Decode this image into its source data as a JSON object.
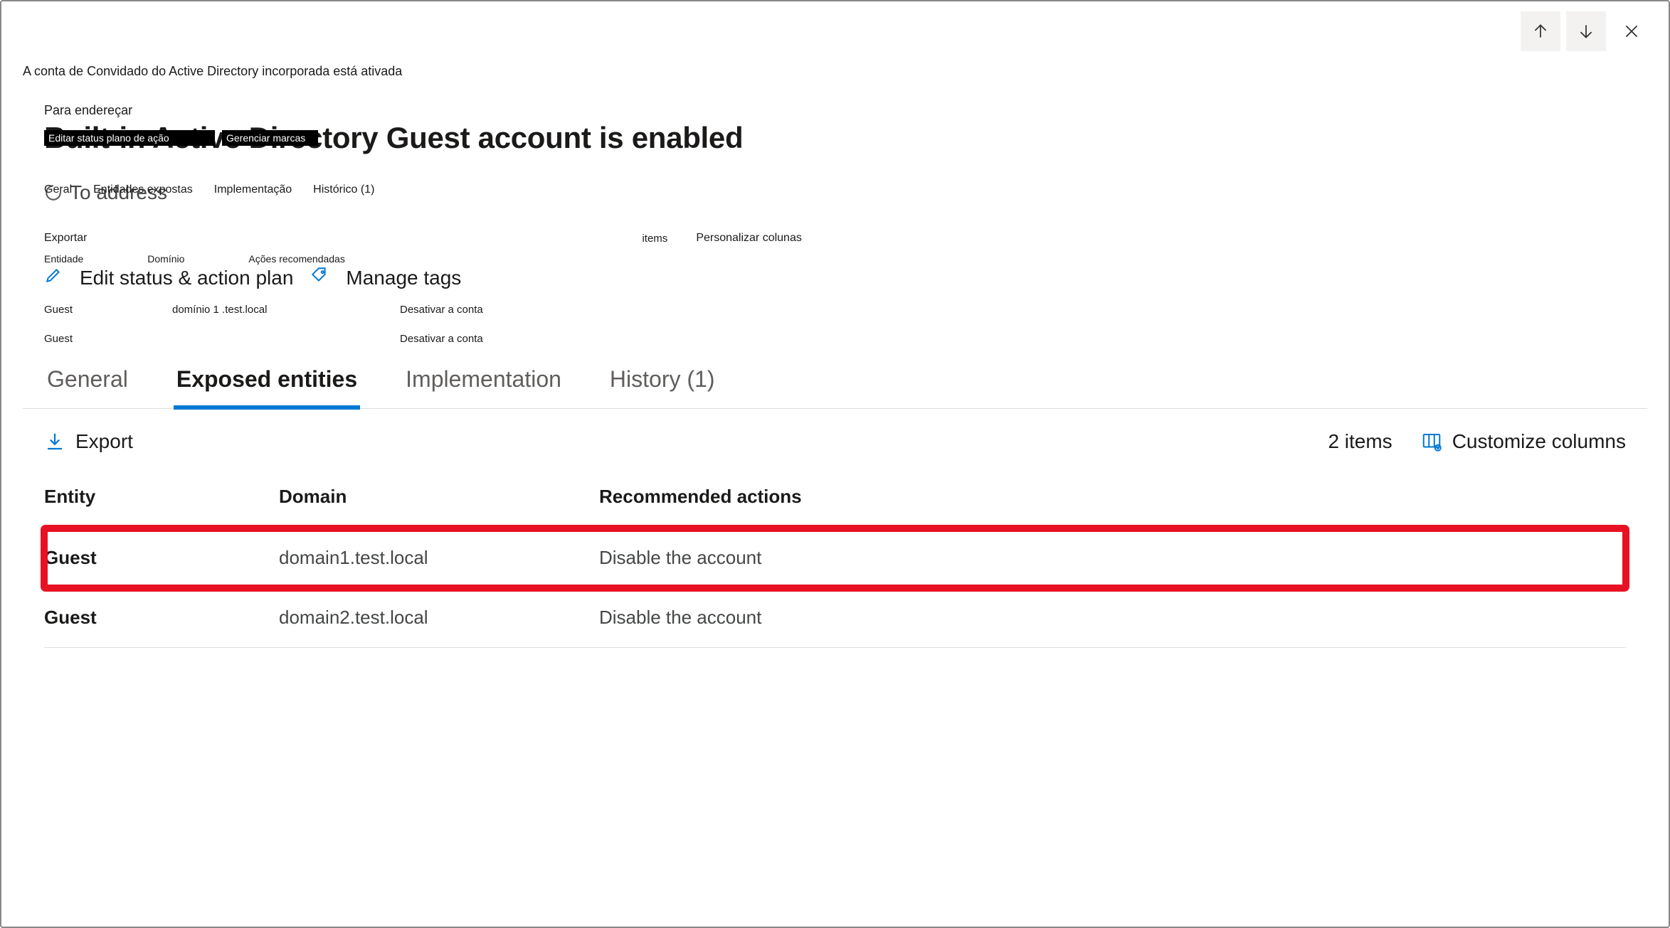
{
  "header_icons": {
    "up": "arrow-up-icon",
    "down": "arrow-down-icon",
    "close": "close-icon"
  },
  "localized_caption": "A conta de Convidado do Active Directory incorporada está ativada",
  "ghost": {
    "subtitle": "Para endereçar",
    "title": "Built-in Active Directory Guest account is enabled",
    "pill_a": "Editar status plano de ação",
    "pill_b": "Gerenciar marcas",
    "to_address": "To address",
    "tabs": [
      "Geral",
      "Entidades expostas",
      "Implementação",
      "Histórico (1)"
    ],
    "export_row": {
      "export": "Exportar",
      "items": "items",
      "customize": "Personalizar colunas"
    },
    "action_row": {
      "mini_labels": [
        "Entidade",
        "Domínio",
        "Ações recomendadas"
      ],
      "edit_label": "Edit status & action plan",
      "manage_label": "Manage tags"
    },
    "table_rows": [
      {
        "entity": "Guest",
        "domain": "domínio 1 .test.local",
        "action": "Desativar a conta"
      },
      {
        "entity": "Guest",
        "domain": "",
        "action": "Desativar a conta"
      }
    ]
  },
  "tabs": [
    {
      "label": "General",
      "active": false
    },
    {
      "label": "Exposed entities",
      "active": true
    },
    {
      "label": "Implementation",
      "active": false
    },
    {
      "label": "History (1)",
      "active": false
    }
  ],
  "toolbar": {
    "export_label": "Export",
    "items_count": "2 items",
    "customize_label": "Customize columns"
  },
  "table": {
    "headers": {
      "entity": "Entity",
      "domain": "Domain",
      "action": "Recommended actions"
    },
    "rows": [
      {
        "entity": "Guest",
        "domain": "domain1.test.local",
        "action": "Disable the account",
        "highlight": true
      },
      {
        "entity": "Guest",
        "domain": "domain2.test.local",
        "action": "Disable the account",
        "highlight": false
      }
    ]
  }
}
